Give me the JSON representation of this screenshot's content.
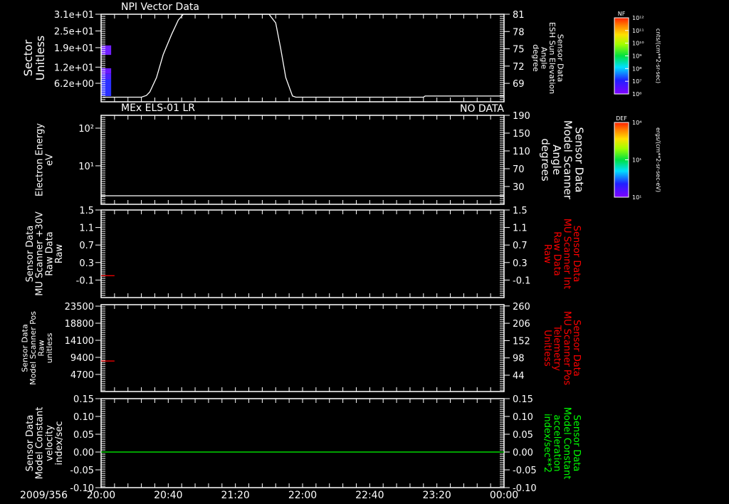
{
  "chart_data": {
    "type": "line",
    "date_label": "2009/356",
    "x_ticks": [
      "20:00",
      "20:40",
      "21:20",
      "22:00",
      "22:40",
      "23:20",
      "00:00"
    ],
    "xlim": [
      "20:00",
      "24:00"
    ],
    "panels": [
      {
        "title": "NPI Vector Data",
        "left_label": [
          "Sector",
          "Unitless"
        ],
        "left_ticks": [
          "3.1e+01",
          "2.5e+01",
          "1.9e+01",
          "1.2e+01",
          "6.2e+00"
        ],
        "left_tick_values": [
          31,
          25,
          19,
          12,
          6.2
        ],
        "left_ylim": [
          -0.45,
          31
        ],
        "right_label": [
          "Sensor Data",
          "ESH Sun Elevation",
          "Angle",
          "degree"
        ],
        "right_label_color": "#ffffff",
        "right_ticks": [
          "81",
          "78",
          "75",
          "72",
          "69"
        ],
        "right_tick_values": [
          81,
          78,
          75,
          72,
          69
        ],
        "right_ylim": [
          65.8,
          81
        ],
        "spectrogram": [
          {
            "t0": "20:00",
            "t1": "20:06",
            "v0": 16.4,
            "v1": 19.8,
            "color": "#7020ff"
          },
          {
            "t0": "20:00",
            "t1": "20:06",
            "v0": 9.6,
            "v1": 11.6,
            "color": "#6a18ff"
          },
          {
            "t0": "20:00",
            "t1": "20:06",
            "v0": 7.6,
            "v1": 9.6,
            "color": "#4a20ff"
          },
          {
            "t0": "20:00",
            "t1": "20:06",
            "v0": 1.6,
            "v1": 7.6,
            "color": "#2a30ff"
          }
        ],
        "line_axis": "right",
        "line_color": "#ffffff",
        "line": [
          [
            "20:01",
            66.6
          ],
          [
            "20:24",
            66.6
          ],
          [
            "20:27",
            66.9
          ],
          [
            "20:29",
            67.5
          ],
          [
            "20:33",
            70
          ],
          [
            "20:37",
            74
          ],
          [
            "20:42",
            77.5
          ],
          [
            "20:46",
            80
          ],
          [
            "20:49",
            81
          ],
          [
            "21:40",
            81
          ],
          [
            "21:44",
            79.5
          ],
          [
            "21:47",
            75
          ],
          [
            "21:50",
            70
          ],
          [
            "21:54",
            66.8
          ],
          [
            "21:56",
            66.6
          ],
          [
            "23:12",
            66.6
          ],
          [
            "23:13",
            66.8
          ],
          [
            "24:00",
            66.8
          ]
        ]
      },
      {
        "title": "MEx ELS-01 LR",
        "status": "NO DATA",
        "left_label": [
          "Electron Energy",
          "eV"
        ],
        "left_ticks": [
          "10²",
          "10¹"
        ],
        "left_tick_values": [
          100,
          10
        ],
        "left_scale": "log",
        "left_ylim": [
          0.95,
          219
        ],
        "right_label": [
          "Sensor Data",
          "Model Scanner",
          "Angle",
          "degrees"
        ],
        "right_label_color": "#ffffff",
        "right_ticks": [
          "190",
          "150",
          "110",
          "70",
          "30"
        ],
        "right_tick_values": [
          190,
          150,
          110,
          70,
          30
        ],
        "right_ylim": [
          -10,
          190
        ],
        "line_axis": "left",
        "line_color": "#ffffff",
        "line": [
          [
            "20:00",
            1.6
          ],
          [
            "24:00",
            1.6
          ]
        ]
      },
      {
        "left_label": [
          "Sensor Data",
          "MU Scanner +30V",
          "Raw Data",
          "Raw"
        ],
        "left_ticks": [
          "1.5",
          "1.1",
          "0.7",
          "0.3",
          "-0.1"
        ],
        "left_tick_values": [
          1.5,
          1.1,
          0.7,
          0.3,
          -0.1
        ],
        "left_ylim": [
          -0.5,
          1.5
        ],
        "right_label": [
          "Sensor Data",
          "MU Scanner Int",
          "Raw Data",
          "Raw"
        ],
        "right_label_color": "#ff0000",
        "right_ticks": [
          "1.5",
          "1.1",
          "0.7",
          "0.3",
          "-0.1"
        ],
        "right_tick_values": [
          1.5,
          1.1,
          0.7,
          0.3,
          -0.1
        ],
        "right_ylim": [
          -0.5,
          1.5
        ],
        "line_axis": "left",
        "line_color": "#ff0000",
        "line": [
          [
            "20:00",
            0.0
          ],
          [
            "20:08",
            0.0
          ]
        ]
      },
      {
        "left_label": [
          "Sensor Data",
          "Model Scanner Pos",
          "Raw",
          "unitless"
        ],
        "left_ticks": [
          "23500",
          "18800",
          "14100",
          "9400",
          "4700"
        ],
        "left_tick_values": [
          23500,
          18800,
          14100,
          9400,
          4700
        ],
        "left_ylim": [
          0,
          23900
        ],
        "right_label": [
          "Sensor Data",
          "MU Scanner Pos",
          "Telemetry",
          "Unitless"
        ],
        "right_label_color": "#ff0000",
        "right_ticks": [
          "260",
          "206",
          "152",
          "98",
          "44"
        ],
        "right_tick_values": [
          260,
          206,
          152,
          98,
          44
        ],
        "right_ylim": [
          -7,
          264
        ],
        "line_axis": "left",
        "line_color": "#ff0000",
        "line": [
          [
            "20:00",
            8400
          ],
          [
            "20:08",
            8400
          ]
        ]
      },
      {
        "left_label": [
          "Sensor Data",
          "Model Constant",
          "velocity",
          "index/sec"
        ],
        "left_ticks": [
          "0.15",
          "0.10",
          "0.05",
          "0.00",
          "-0.05",
          "-0.10"
        ],
        "left_tick_values": [
          0.15,
          0.1,
          0.05,
          0.0,
          -0.05,
          -0.1
        ],
        "left_ylim": [
          -0.1,
          0.15
        ],
        "right_label": [
          "Sensor Data",
          "Model Constant",
          "acceleration",
          "index/sec**2"
        ],
        "right_label_color": "#00ff00",
        "right_ticks": [
          "0.15",
          "0.10",
          "0.05",
          "0.00",
          "-0.05",
          "-0.10"
        ],
        "right_tick_values": [
          0.15,
          0.1,
          0.05,
          0.0,
          -0.05,
          -0.1
        ],
        "right_ylim": [
          -0.1,
          0.15
        ],
        "line_axis": "left",
        "line_color": "#00ff00",
        "line": [
          [
            "20:00",
            0.0
          ],
          [
            "24:00",
            0.0
          ]
        ]
      }
    ],
    "colorbars": [
      {
        "title": "NF",
        "ticks": [
          "10¹²",
          "10¹¹",
          "10¹⁰",
          "10⁹",
          "10⁸",
          "10⁷",
          "10⁶"
        ],
        "unit": "cnts/(cm**2-sr-sec)"
      },
      {
        "title": "DEF",
        "ticks": [
          "10⁴",
          "10¹",
          "10¹"
        ],
        "unit": "ergs/(cm**2-sr-sec-eV)"
      }
    ]
  }
}
